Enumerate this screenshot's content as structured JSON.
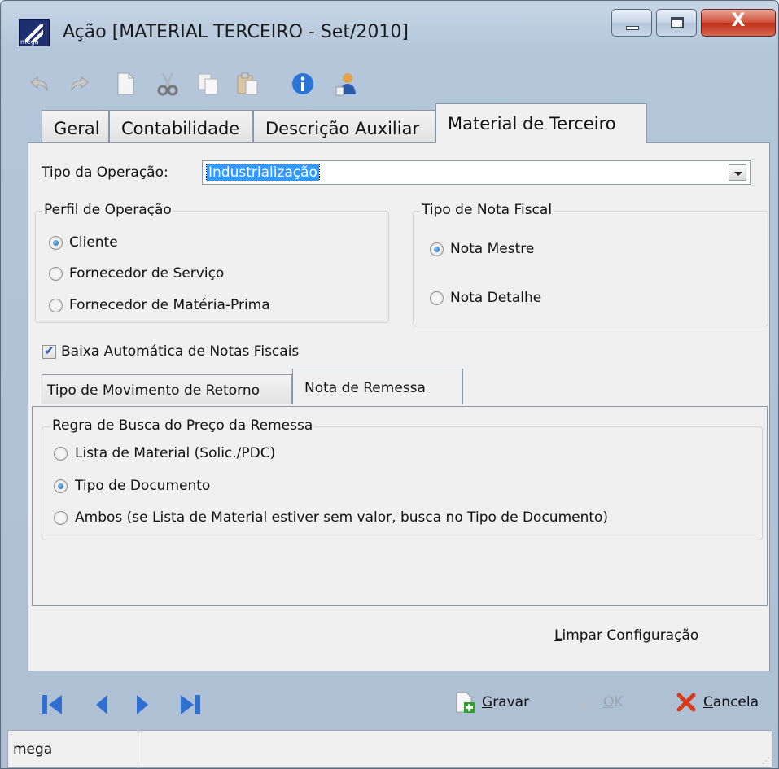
{
  "window": {
    "title": "Ação [MATERIAL TERCEIRO - Set/2010]",
    "app_icon_text": "mega",
    "controls": {
      "minimize": "–",
      "maximize": "□",
      "close": "X"
    }
  },
  "toolbar": {
    "icons": [
      "undo-icon",
      "redo-icon",
      "new-document-icon",
      "cut-icon",
      "copy-icon",
      "paste-icon",
      "info-icon",
      "user-icon"
    ]
  },
  "tabs": [
    {
      "label": "Geral"
    },
    {
      "label": "Contabilidade"
    },
    {
      "label": "Descrição Auxiliar"
    },
    {
      "label": "Material de Terceiro",
      "active": true
    }
  ],
  "form": {
    "tipo_operacao_label": "Tipo da Operação:",
    "tipo_operacao_value": "Industrialização",
    "perfil": {
      "legend": "Perfil de Operação",
      "options": [
        "Cliente",
        "Fornecedor de Serviço",
        "Fornecedor de Matéria-Prima"
      ],
      "selected": "Cliente"
    },
    "nota_fiscal": {
      "legend": "Tipo de Nota Fiscal",
      "options": [
        "Nota Mestre",
        "Nota Detalhe"
      ],
      "selected": "Nota Mestre"
    },
    "baixa_automatica_label": "Baixa Automática de Notas Fiscais",
    "baixa_automatica_checked": true
  },
  "subtabs": [
    {
      "label": "Tipo de Movimento de Retorno"
    },
    {
      "label": "Nota de Remessa",
      "active": true
    }
  ],
  "regra": {
    "legend": "Regra de Busca do Preço da Remessa",
    "options": [
      "Lista de Material (Solic./PDC)",
      "Tipo de Documento",
      "Ambos (se Lista de Material estiver sem valor, busca no Tipo de Documento)"
    ],
    "selected": "Tipo de Documento"
  },
  "limpar": {
    "first": "L",
    "rest": "impar Configuração"
  },
  "actions": {
    "gravar": {
      "first": "G",
      "rest": "ravar"
    },
    "ok": {
      "first": "O",
      "rest": "K"
    },
    "cancela": {
      "first": "C",
      "rest": "ancela"
    }
  },
  "status": {
    "user": "mega"
  },
  "colors": {
    "selection": "#3399ff",
    "nav_blue": "#2e6fd0",
    "cancel_red": "#d83a1a",
    "gravar_green": "#2fa02f"
  }
}
